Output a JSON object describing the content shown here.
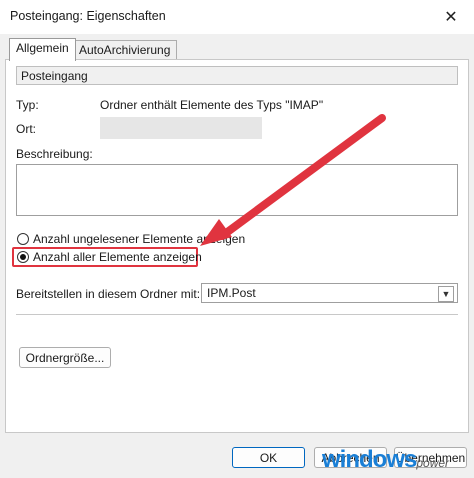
{
  "window": {
    "title": "Posteingang: Eigenschaften",
    "close_glyph": "✕"
  },
  "tabs": [
    {
      "label": "Allgemein",
      "active": true
    },
    {
      "label": "AutoArchivierung",
      "active": false
    }
  ],
  "general": {
    "folder_name": "Posteingang",
    "type_label": "Typ:",
    "type_value": "Ordner enthält Elemente des Typs \"IMAP\"",
    "location_label": "Ort:",
    "description_label": "Beschreibung:",
    "radio_unread": {
      "label": "Anzahl ungelesener Elemente anzeigen",
      "checked": false
    },
    "radio_all": {
      "label": "Anzahl aller Elemente anzeigen",
      "checked": true
    },
    "post_label": "Bereitstellen in diesem Ordner mit:",
    "post_value": "IPM.Post",
    "folder_size_button": "Ordnergröße..."
  },
  "footer": {
    "ok": "OK",
    "cancel": "Abbrechen",
    "apply": "Übernehmen"
  },
  "annotation": {
    "color": "#e0343f"
  },
  "watermark": {
    "part1": "windows",
    "part2": "power"
  }
}
